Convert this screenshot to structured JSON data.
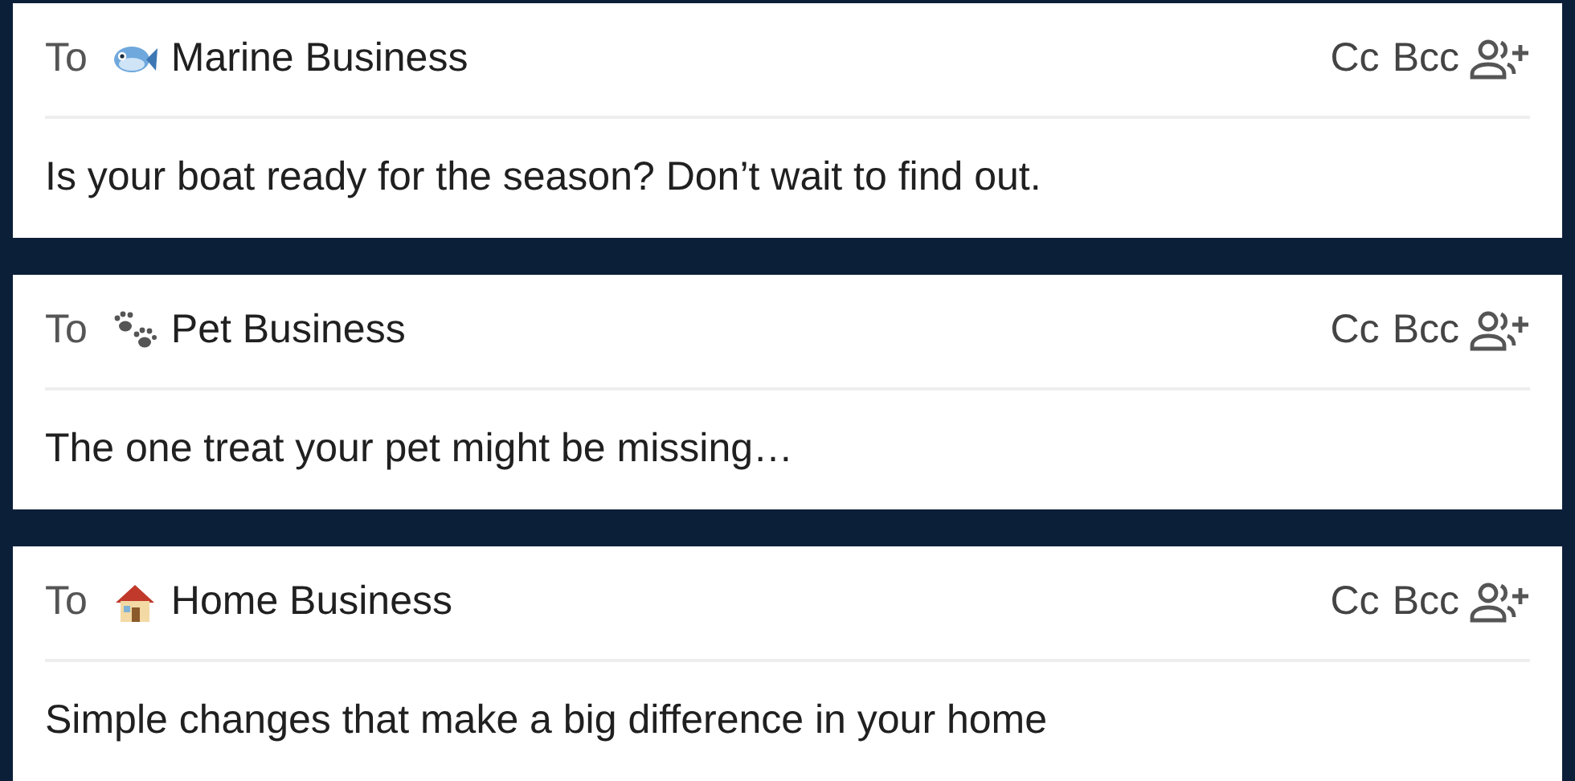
{
  "emails": [
    {
      "to_label": "To",
      "recipient": {
        "kind": "fish",
        "name": "Marine Business"
      },
      "cc": "Cc",
      "bcc": "Bcc",
      "subject": "Is your boat ready for the season? Don’t wait to find out."
    },
    {
      "to_label": "To",
      "recipient": {
        "kind": "paws",
        "name": "Pet Business"
      },
      "cc": "Cc",
      "bcc": "Bcc",
      "subject": "The one treat your pet might be missing…"
    },
    {
      "to_label": "To",
      "recipient": {
        "kind": "house",
        "name": "Home Business"
      },
      "cc": "Cc",
      "bcc": "Bcc",
      "subject": "Simple changes that make a big difference in your home"
    }
  ]
}
